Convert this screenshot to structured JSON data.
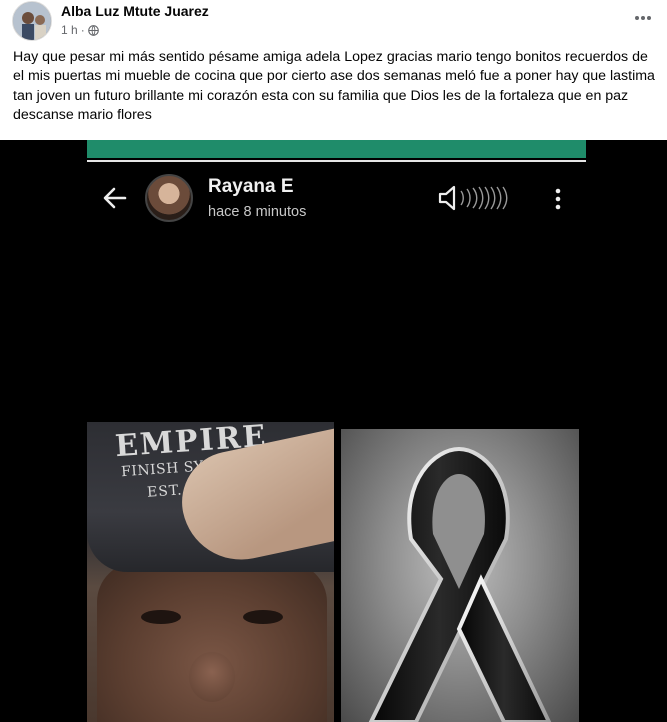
{
  "post": {
    "author": "Alba Luz Mtute Juarez",
    "time": "1 h",
    "dot": "·",
    "text": "Hay que pesar mi más sentido pésame amiga adela Lopez gracias mario tengo bonitos recuerdos de el mis puertas mi mueble de cocina que  por cierto ase dos semanas meló fue a poner hay que lastima tan joven  un futuro brillante mi corazón esta con su familia que  Dios les de la fortaleza que  en paz descanse mario flores"
  },
  "status": {
    "name": "Rayana E",
    "time": "hace 8 minutos"
  },
  "cap_print": {
    "line1": "EMPIRE",
    "line2": "FINISH SYSTEMS, LLC",
    "line3": "EST. 1996"
  },
  "icons": {
    "more": "more-horizontal-icon",
    "privacy": "globe-icon",
    "back": "arrow-left-icon",
    "volume": "speaker-icon",
    "menu": "more-vertical-icon",
    "ribbon": "mourning-ribbon-icon"
  },
  "colors": {
    "status_header": "#1f8c6a",
    "meta_gray": "#65676b"
  }
}
